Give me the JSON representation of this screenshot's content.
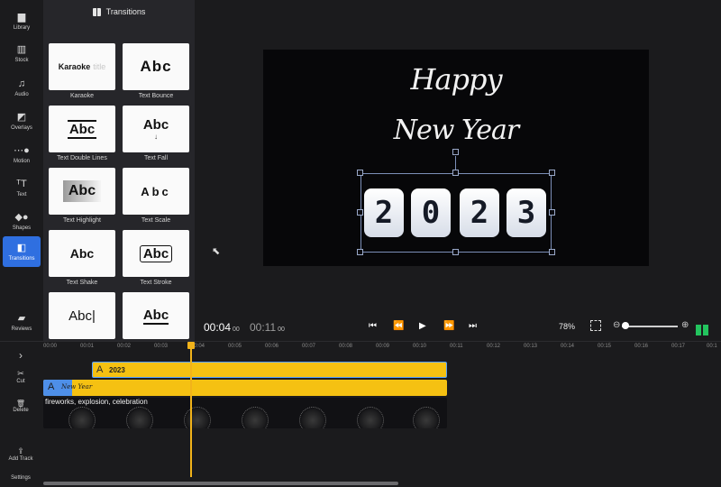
{
  "rail": {
    "items": [
      {
        "key": "library",
        "label": "Library",
        "icon": "▆"
      },
      {
        "key": "stock",
        "label": "Stock",
        "icon": "▥"
      },
      {
        "key": "audio",
        "label": "Audio",
        "icon": "♫"
      },
      {
        "key": "overlays",
        "label": "Overlays",
        "icon": "◩"
      },
      {
        "key": "motion",
        "label": "Motion",
        "icon": "⋯●"
      },
      {
        "key": "text",
        "label": "Text",
        "icon": "ᵀT"
      },
      {
        "key": "shapes",
        "label": "Shapes",
        "icon": "◆●"
      },
      {
        "key": "transitions",
        "label": "Transitions",
        "icon": "◧"
      },
      {
        "key": "reviews",
        "label": "Reviews",
        "icon": "▰"
      }
    ],
    "active": "transitions"
  },
  "panel": {
    "title": "Transitions",
    "tiles": [
      {
        "label": "Karaoke",
        "preview_main": "Karaoke",
        "preview_sub": "title"
      },
      {
        "label": "Text Bounce",
        "preview_main": "Abc"
      },
      {
        "label": "Text Double Lines",
        "preview_main": "Abc"
      },
      {
        "label": "Text Fall",
        "preview_main": "Abc",
        "preview_sub": "↓"
      },
      {
        "label": "Text Highlight",
        "preview_main": "Abc"
      },
      {
        "label": "Text Scale",
        "preview_main": "Abc"
      },
      {
        "label": "Text Shake",
        "preview_main": "Abc"
      },
      {
        "label": "Text Stroke",
        "preview_main": "Abc"
      },
      {
        "label": "",
        "preview_main": "Abc|"
      },
      {
        "label": "",
        "preview_main": "Abc"
      }
    ]
  },
  "canvas": {
    "line1": "Happy",
    "line2": "New Year",
    "digits": [
      "2",
      "0",
      "2",
      "3"
    ]
  },
  "transport": {
    "current": "00:04",
    "current_frames": "00",
    "total": "00:11",
    "total_frames": "00",
    "zoom": "78%",
    "btn_start": "⏮",
    "btn_back": "⏪",
    "btn_play": "▶",
    "btn_forward": "⏩",
    "btn_end": "⏭",
    "zoom_out_icon": "⊖",
    "zoom_in_icon": "⊕"
  },
  "timeline": {
    "rail": [
      {
        "key": "expand",
        "icon": "›",
        "label": ""
      },
      {
        "key": "cut",
        "icon": "✂",
        "label": "Cut"
      },
      {
        "key": "delete",
        "icon": "🗑",
        "label": "Delete"
      },
      {
        "key": "add-track",
        "icon": "⇪",
        "label": "Add Track"
      },
      {
        "key": "settings",
        "icon": "",
        "label": "Settings"
      }
    ],
    "ruler": [
      "00:00",
      "00:01",
      "00:02",
      "00:03",
      "00:04",
      "00:05",
      "00:06",
      "00:07",
      "00:08",
      "00:09",
      "00:10",
      "00:11",
      "00:12",
      "00:13",
      "00:14",
      "00:15",
      "00:16",
      "00:17",
      "00:1"
    ],
    "clips": {
      "title_clip_text": "2023",
      "title_clip_icon": "A",
      "ny_clip_icon": "A",
      "ny_clip_text": "New Year",
      "video_clip_text": "fireworks, explosion, celebration"
    }
  }
}
